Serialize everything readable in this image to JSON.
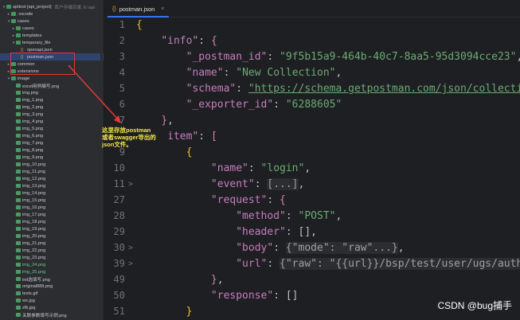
{
  "project": {
    "name": "apitest",
    "module": "[api_project]",
    "path_hint": "库户存储目录, E:\\api..."
  },
  "tree": [
    {
      "label": "apitest [api_project]",
      "depth": 0,
      "type": "folder",
      "open": true,
      "hint": "库户存储目录, E:\\api"
    },
    {
      "label": ".vscode",
      "depth": 1,
      "type": "folder",
      "open": false
    },
    {
      "label": "cases",
      "depth": 1,
      "type": "folder",
      "open": true
    },
    {
      "label": "cases",
      "depth": 2,
      "type": "folder",
      "open": false
    },
    {
      "label": "templates",
      "depth": 2,
      "type": "folder",
      "open": false
    },
    {
      "label": "temporary_file",
      "depth": 2,
      "type": "folder",
      "open": true
    },
    {
      "label": "openapi.json",
      "depth": 3,
      "type": "json"
    },
    {
      "label": "postman.json",
      "depth": 3,
      "type": "json",
      "selected": true
    },
    {
      "label": "common",
      "depth": 1,
      "type": "folder",
      "open": false
    },
    {
      "label": "extensions",
      "depth": 1,
      "type": "folder",
      "open": false
    },
    {
      "label": "image",
      "depth": 1,
      "type": "folder",
      "open": true
    },
    {
      "label": "excel用例编写.png",
      "depth": 2,
      "type": "img"
    },
    {
      "label": "img.png",
      "depth": 2,
      "type": "img"
    },
    {
      "label": "img_1.png",
      "depth": 2,
      "type": "img"
    },
    {
      "label": "img_2.png",
      "depth": 2,
      "type": "img"
    },
    {
      "label": "img_3.png",
      "depth": 2,
      "type": "img"
    },
    {
      "label": "img_4.png",
      "depth": 2,
      "type": "img"
    },
    {
      "label": "img_5.png",
      "depth": 2,
      "type": "img"
    },
    {
      "label": "img_6.png",
      "depth": 2,
      "type": "img"
    },
    {
      "label": "img_7.png",
      "depth": 2,
      "type": "img"
    },
    {
      "label": "img_8.png",
      "depth": 2,
      "type": "img"
    },
    {
      "label": "img_9.png",
      "depth": 2,
      "type": "img"
    },
    {
      "label": "img_10.png",
      "depth": 2,
      "type": "img"
    },
    {
      "label": "img_11.png",
      "depth": 2,
      "type": "img"
    },
    {
      "label": "img_12.png",
      "depth": 2,
      "type": "img"
    },
    {
      "label": "img_13.png",
      "depth": 2,
      "type": "img"
    },
    {
      "label": "img_14.png",
      "depth": 2,
      "type": "img"
    },
    {
      "label": "img_15.png",
      "depth": 2,
      "type": "img"
    },
    {
      "label": "img_16.png",
      "depth": 2,
      "type": "img"
    },
    {
      "label": "img_17.png",
      "depth": 2,
      "type": "img"
    },
    {
      "label": "img_18.png",
      "depth": 2,
      "type": "img"
    },
    {
      "label": "img_19.png",
      "depth": 2,
      "type": "img"
    },
    {
      "label": "img_20.png",
      "depth": 2,
      "type": "img"
    },
    {
      "label": "img_21.png",
      "depth": 2,
      "type": "img"
    },
    {
      "label": "img_22.png",
      "depth": 2,
      "type": "img"
    },
    {
      "label": "img_23.png",
      "depth": 2,
      "type": "img"
    },
    {
      "label": "img_24.png",
      "depth": 2,
      "type": "img",
      "green": true
    },
    {
      "label": "img_25.png",
      "depth": 2,
      "type": "img",
      "green": true
    },
    {
      "label": "init选填写.png",
      "depth": 2,
      "type": "img"
    },
    {
      "label": "original888.png",
      "depth": 2,
      "type": "img"
    },
    {
      "label": "tests.gif",
      "depth": 2,
      "type": "img"
    },
    {
      "label": "wx.jpg",
      "depth": 2,
      "type": "img"
    },
    {
      "label": "zfb.jpg",
      "depth": 2,
      "type": "img"
    },
    {
      "label": "关联参数填写示例.png",
      "depth": 2,
      "type": "img"
    }
  ],
  "tab": {
    "label": "postman.json",
    "close": "×"
  },
  "annotation": {
    "line1": "这里存放postman",
    "line2": "或者swagger导出的",
    "line3": "json文件。"
  },
  "lines": [
    {
      "n": "1",
      "fold": "",
      "segs": [
        [
          "b1",
          "{"
        ]
      ]
    },
    {
      "n": "2",
      "fold": "",
      "segs": [
        [
          "p",
          "    "
        ],
        [
          "k",
          "\"info\""
        ],
        [
          "p",
          ": "
        ],
        [
          "b2",
          "{"
        ]
      ]
    },
    {
      "n": "3",
      "fold": "",
      "segs": [
        [
          "p",
          "        "
        ],
        [
          "k",
          "\"_postman_id\""
        ],
        [
          "p",
          ": "
        ],
        [
          "s",
          "\"9f5b15a9-464b-40c7-8aa5-95d3094cce23\""
        ],
        [
          "p",
          ","
        ]
      ]
    },
    {
      "n": "4",
      "fold": "",
      "segs": [
        [
          "p",
          "        "
        ],
        [
          "k",
          "\"name\""
        ],
        [
          "p",
          ": "
        ],
        [
          "s",
          "\"New Collection\""
        ],
        [
          "p",
          ","
        ]
      ]
    },
    {
      "n": "5",
      "fold": "",
      "segs": [
        [
          "p",
          "        "
        ],
        [
          "k",
          "\"schema\""
        ],
        [
          "p",
          ": "
        ],
        [
          "u",
          "\"https://schema.getpostman.com/json/collection"
        ]
      ]
    },
    {
      "n": "6",
      "fold": "",
      "segs": [
        [
          "p",
          "        "
        ],
        [
          "k",
          "\"_exporter_id\""
        ],
        [
          "p",
          ": "
        ],
        [
          "s",
          "\"6288605\""
        ]
      ]
    },
    {
      "n": "7",
      "fold": "",
      "segs": [
        [
          "p",
          "    "
        ],
        [
          "b2",
          "}"
        ],
        [
          "p",
          ","
        ]
      ]
    },
    {
      "n": "8",
      "fold": "",
      "segs": [
        [
          "p",
          "    "
        ],
        [
          "k",
          "\"item\""
        ],
        [
          "p",
          ": "
        ],
        [
          "b2",
          "["
        ]
      ]
    },
    {
      "n": "9",
      "fold": "",
      "segs": [
        [
          "p",
          "        "
        ],
        [
          "b1",
          "{"
        ]
      ]
    },
    {
      "n": "10",
      "fold": "",
      "segs": [
        [
          "p",
          "            "
        ],
        [
          "k",
          "\"name\""
        ],
        [
          "p",
          ": "
        ],
        [
          "s",
          "\"login\""
        ],
        [
          "p",
          ","
        ]
      ]
    },
    {
      "n": "11",
      "fold": ">",
      "segs": [
        [
          "p",
          "            "
        ],
        [
          "k",
          "\"event\""
        ],
        [
          "p",
          ": "
        ],
        [
          "fo",
          "[...]"
        ],
        [
          "p",
          ","
        ]
      ]
    },
    {
      "n": "27",
      "fold": "",
      "segs": [
        [
          "p",
          "            "
        ],
        [
          "k",
          "\"request\""
        ],
        [
          "p",
          ": "
        ],
        [
          "b2",
          "{"
        ]
      ]
    },
    {
      "n": "28",
      "fold": "",
      "segs": [
        [
          "p",
          "                "
        ],
        [
          "k",
          "\"method\""
        ],
        [
          "p",
          ": "
        ],
        [
          "s",
          "\"POST\""
        ],
        [
          "p",
          ","
        ]
      ]
    },
    {
      "n": "29",
      "fold": "",
      "segs": [
        [
          "p",
          "                "
        ],
        [
          "k",
          "\"header\""
        ],
        [
          "p",
          ": "
        ],
        [
          "p",
          "[],"
        ]
      ]
    },
    {
      "n": "30",
      "fold": ">",
      "segs": [
        [
          "p",
          "                "
        ],
        [
          "k",
          "\"body\""
        ],
        [
          "p",
          ": "
        ],
        [
          "fo",
          "{\"mode\": \"raw\"...}"
        ],
        [
          "p",
          ","
        ]
      ]
    },
    {
      "n": "39",
      "fold": ">",
      "segs": [
        [
          "p",
          "                "
        ],
        [
          "k",
          "\"url\""
        ],
        [
          "p",
          ": "
        ],
        [
          "fo",
          "{\"raw\": \"{{url}}/bsp/test/user/ugs/auth/l"
        ]
      ]
    },
    {
      "n": "49",
      "fold": "",
      "segs": [
        [
          "p",
          "            "
        ],
        [
          "b2",
          "}"
        ],
        [
          "p",
          ","
        ]
      ]
    },
    {
      "n": "50",
      "fold": "",
      "segs": [
        [
          "p",
          "            "
        ],
        [
          "k",
          "\"response\""
        ],
        [
          "p",
          ": "
        ],
        [
          "p",
          "[]"
        ]
      ]
    },
    {
      "n": "51",
      "fold": "",
      "segs": [
        [
          "p",
          "        "
        ],
        [
          "b1",
          "}"
        ]
      ]
    }
  ],
  "watermark": "CSDN @bug捕手"
}
